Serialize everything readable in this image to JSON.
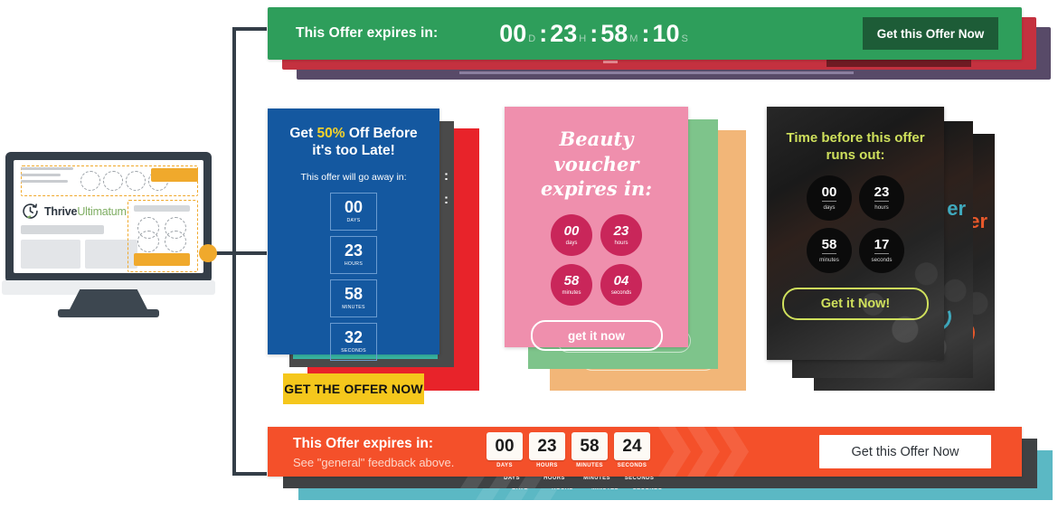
{
  "monitor": {
    "logo_primary": "Thrive",
    "logo_secondary": "Ultimatum",
    "icon": "clock-leaf-icon"
  },
  "top_banner": {
    "label": "This Offer expires in:",
    "countdown": [
      {
        "value": "00",
        "unit": "D"
      },
      {
        "value": "23",
        "unit": "H"
      },
      {
        "value": "58",
        "unit": "M"
      },
      {
        "value": "10",
        "unit": "S"
      }
    ],
    "separator": ":",
    "cta": "Get this Offer Now",
    "colors": {
      "front": "#2e9e5b",
      "mid": "#c4313f",
      "back": "#584a68",
      "cta": "#1d5c37"
    }
  },
  "blue_card": {
    "heading_pre": "Get ",
    "heading_highlight": "50%",
    "heading_post": " Off Before",
    "heading_line2": "it's too Late!",
    "subtitle": "This offer will go away in:",
    "countdown": [
      {
        "value": "00",
        "label": "DAYS"
      },
      {
        "value": "23",
        "label": "HOURS"
      },
      {
        "value": "58",
        "label": "MINUTES"
      },
      {
        "value": "32",
        "label": "SECONDS"
      }
    ],
    "cta": "GET THE OFFER NOW",
    "colors": {
      "front": "#1458a0",
      "mid": "#4a4a4a",
      "back": "#e8232a",
      "accent": "#37b6a4",
      "cta": "#f5c71c",
      "highlight": "#f5d22b"
    }
  },
  "pink_card": {
    "heading_line1": "Beauty voucher",
    "heading_line2": "expires in:",
    "countdown": [
      {
        "value": "00",
        "label": "days"
      },
      {
        "value": "23",
        "label": "hours"
      },
      {
        "value": "58",
        "label": "minutes"
      },
      {
        "value": "04",
        "label": "seconds"
      }
    ],
    "cta": "get it now",
    "colors": {
      "front": "#ef8fad",
      "mid": "#7ec48b",
      "back": "#f2b678",
      "bubble": "#c9265a"
    }
  },
  "dark_card": {
    "heading_line1": "Time before this offer",
    "heading_line2": "runs out:",
    "countdown": [
      {
        "value": "00",
        "label": "days"
      },
      {
        "value": "23",
        "label": "hours"
      },
      {
        "value": "58",
        "label": "minutes"
      },
      {
        "value": "17",
        "label": "seconds"
      }
    ],
    "cta": "Get it Now!",
    "ghost_text": "er",
    "colors": {
      "accent_front": "#cfe05c",
      "accent_mid": "#3fa9bd",
      "accent_back": "#e8582a"
    }
  },
  "bottom_banner": {
    "title": "This Offer expires in:",
    "subtitle": "See \"general\" feedback above.",
    "countdown": [
      {
        "value": "00",
        "label": "DAYS"
      },
      {
        "value": "23",
        "label": "HOURS"
      },
      {
        "value": "58",
        "label": "MINUTES"
      },
      {
        "value": "24",
        "label": "SECONDS"
      }
    ],
    "cta": "Get this Offer Now",
    "colors": {
      "front": "#f4502a",
      "mid": "#3f4244",
      "back": "#5bb8c4"
    }
  }
}
